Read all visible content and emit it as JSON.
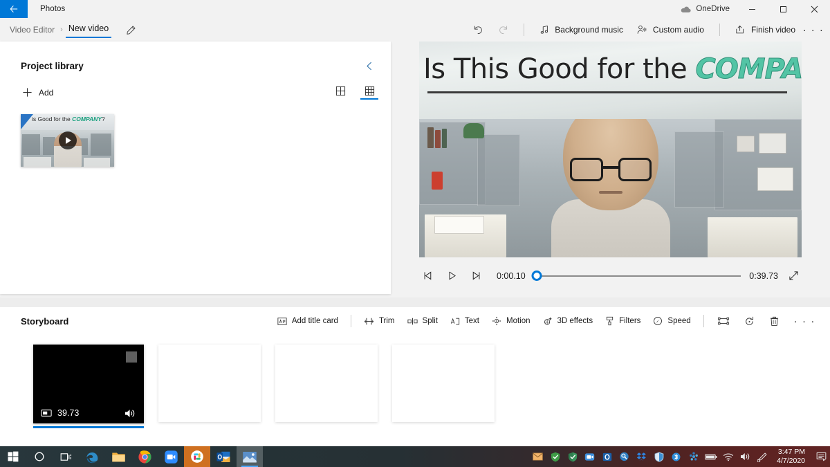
{
  "titlebar": {
    "back_icon": "back-arrow-icon",
    "app_name": "Photos",
    "onedrive_label": "OneDrive",
    "onedrive_icon": "cloud-icon",
    "minimize_label": "—",
    "maximize_label": "❐",
    "close_label": "✕"
  },
  "commandbar": {
    "breadcrumb": {
      "parent": "Video Editor",
      "separator": "›",
      "current": "New video"
    },
    "rename_icon": "pencil-icon",
    "undo_icon": "undo-icon",
    "redo_icon": "redo-icon",
    "actions": [
      {
        "label": "Background music",
        "icon": "music-note-icon"
      },
      {
        "label": "Custom audio",
        "icon": "person-audio-icon"
      },
      {
        "label": "Finish video",
        "icon": "export-icon"
      }
    ],
    "overflow_label": "· · ·"
  },
  "library": {
    "title": "Project library",
    "collapse_icon": "chevron-left-icon",
    "add_label": "Add",
    "add_icon": "plus-icon",
    "view_large_icon": "grid-large-icon",
    "view_small_icon": "grid-small-icon",
    "view_selected": "grid-small-icon",
    "items": [
      {
        "name": "video-thumbnail",
        "banner_prefix": "is Good for the ",
        "banner_highlight": "COMPANY",
        "banner_suffix": "?",
        "play_icon": "play-icon"
      }
    ]
  },
  "preview": {
    "video": {
      "sign_text_prefix": "Is This Good for the ",
      "sign_text_highlight": "COMPANY",
      "sign_text_suffix": "?"
    },
    "controls": {
      "prev_frame_icon": "previous-frame-icon",
      "play_icon": "play-icon",
      "next_frame_icon": "next-frame-icon",
      "current_time": "0:00.10",
      "total_time": "0:39.73",
      "progress_percent": 1.5,
      "fullscreen_icon": "expand-icon"
    }
  },
  "storyboard": {
    "title": "Storyboard",
    "tools": [
      {
        "label": "Add title card",
        "icon": "title-card-icon"
      },
      {
        "label": "Trim",
        "icon": "trim-icon"
      },
      {
        "label": "Split",
        "icon": "split-icon"
      },
      {
        "label": "Text",
        "icon": "text-icon"
      },
      {
        "label": "Motion",
        "icon": "motion-icon"
      },
      {
        "label": "3D effects",
        "icon": "3d-effects-icon"
      },
      {
        "label": "Filters",
        "icon": "filters-icon"
      },
      {
        "label": "Speed",
        "icon": "speed-icon"
      }
    ],
    "icon_tools": [
      {
        "icon": "resize-icon"
      },
      {
        "icon": "rotate-icon"
      },
      {
        "icon": "delete-icon"
      }
    ],
    "overflow_label": "· · ·",
    "clips": [
      {
        "duration": "39.73",
        "aspect_icon": "aspect-ratio-icon",
        "audio_icon": "volume-icon",
        "selected": true
      }
    ],
    "empty_slots": 3
  },
  "taskbar": {
    "start_icon": "windows-start-icon",
    "search_icon": "search-circle-icon",
    "taskview_icon": "task-view-icon",
    "apps": [
      {
        "icon": "edge-icon",
        "name": "microsoft-edge"
      },
      {
        "icon": "file-explorer-icon",
        "name": "file-explorer"
      },
      {
        "icon": "chrome-icon",
        "name": "google-chrome"
      },
      {
        "icon": "zoom-icon",
        "name": "zoom"
      },
      {
        "icon": "slack-icon",
        "name": "slack"
      },
      {
        "icon": "outlook-icon",
        "name": "outlook"
      },
      {
        "icon": "photos-icon",
        "name": "photos"
      }
    ],
    "tray": [
      {
        "icon": "mail-icon"
      },
      {
        "icon": "shield-green-icon"
      },
      {
        "icon": "shield-security-icon"
      },
      {
        "icon": "teams-icon"
      },
      {
        "icon": "outlook-tray-icon"
      },
      {
        "icon": "search-tray-icon"
      },
      {
        "icon": "dropbox-icon"
      },
      {
        "icon": "defender-icon"
      },
      {
        "icon": "bluetooth-icon"
      },
      {
        "icon": "sync-icon"
      },
      {
        "icon": "battery-icon"
      },
      {
        "icon": "wifi-icon"
      },
      {
        "icon": "volume-icon"
      },
      {
        "icon": "pen-icon"
      }
    ],
    "clock": {
      "time": "3:47 PM",
      "date": "4/7/2020"
    },
    "action_center_icon": "action-center-icon"
  },
  "colors": {
    "accent": "#0078d7",
    "titlebar_bg": "#f2f2f2",
    "panel_bg": "#ffffff",
    "highlight_green": "#53c4a5"
  }
}
